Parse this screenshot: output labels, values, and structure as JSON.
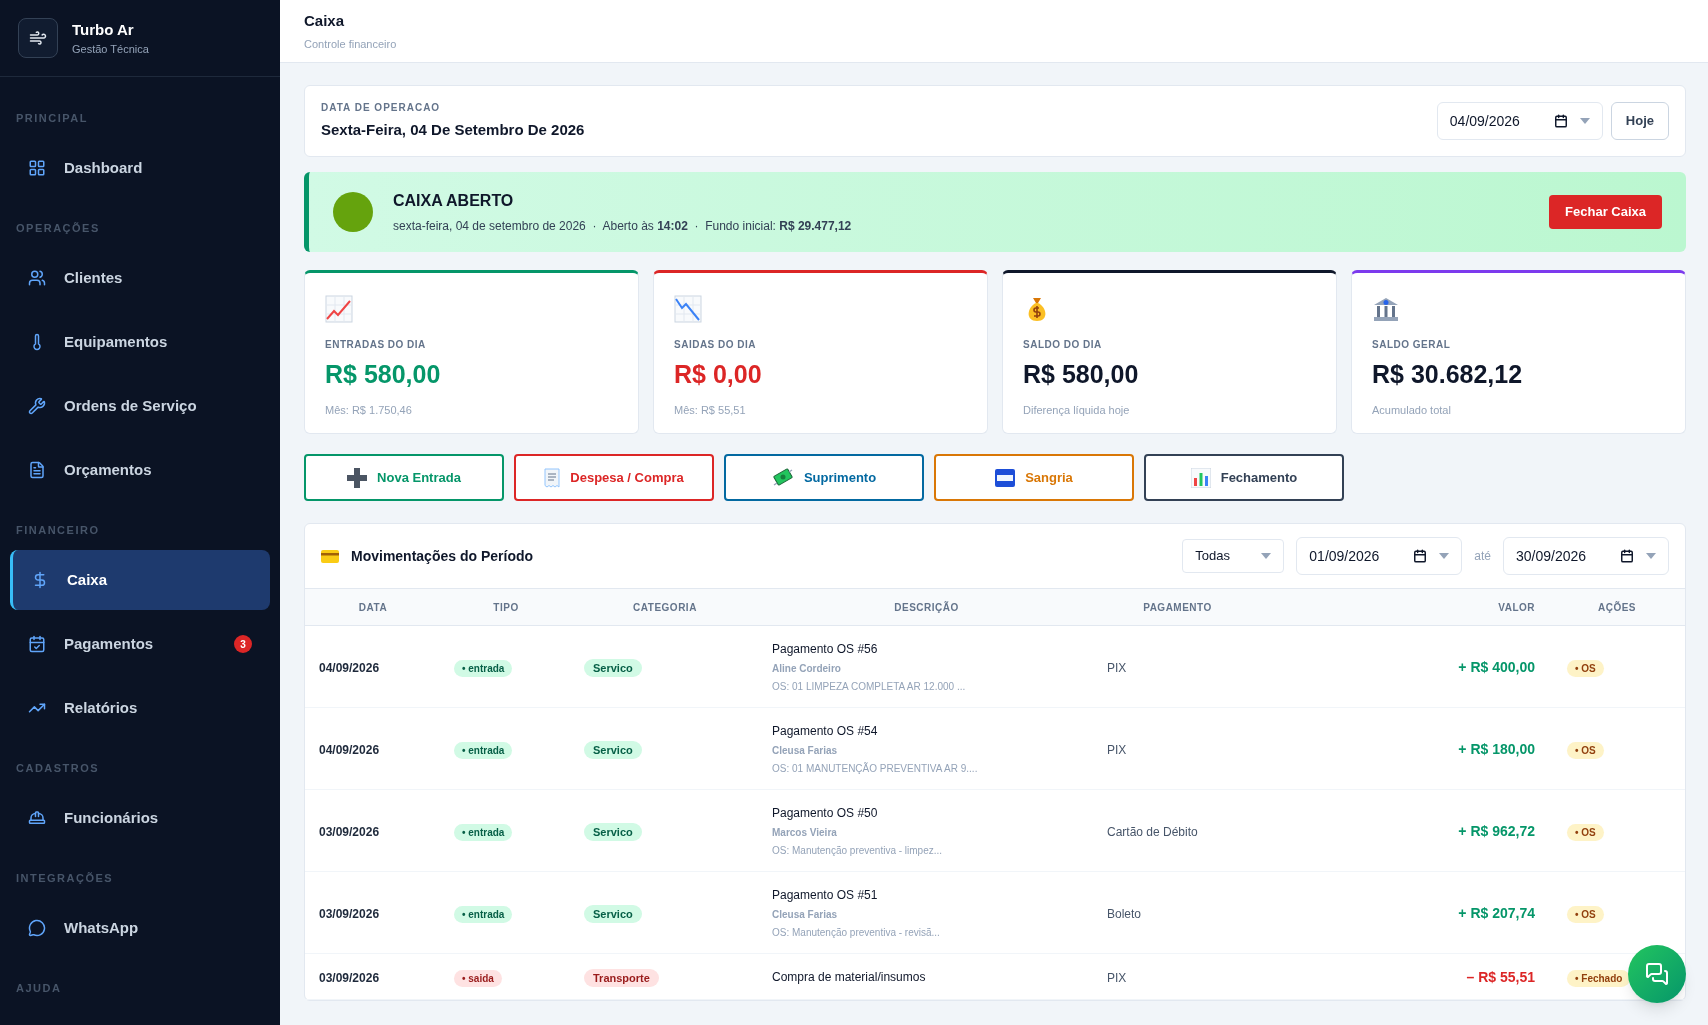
{
  "brand": {
    "name": "Turbo Ar",
    "subtitle": "Gestão Técnica"
  },
  "sidebar": {
    "sections": [
      {
        "label": "PRINCIPAL",
        "items": [
          {
            "label": "Dashboard",
            "selected": false
          }
        ]
      },
      {
        "label": "OPERAÇÕES",
        "items": [
          {
            "label": "Clientes",
            "selected": false
          },
          {
            "label": "Equipamentos",
            "selected": false
          },
          {
            "label": "Ordens de Serviço",
            "selected": false
          },
          {
            "label": "Orçamentos",
            "selected": false
          }
        ]
      },
      {
        "label": "FINANCEIRO",
        "items": [
          {
            "label": "Caixa",
            "selected": true
          },
          {
            "label": "Pagamentos",
            "selected": false,
            "badge": "3"
          },
          {
            "label": "Relatórios",
            "selected": false
          }
        ]
      },
      {
        "label": "CADASTROS",
        "items": [
          {
            "label": "Funcionários",
            "selected": false
          }
        ]
      },
      {
        "label": "INTEGRAÇÕES",
        "items": [
          {
            "label": "WhatsApp",
            "selected": false
          }
        ]
      },
      {
        "label": "AJUDA"
      }
    ]
  },
  "header": {
    "title": "Caixa",
    "subtitle": "Controle financeiro"
  },
  "operation_date": {
    "label": "DATA DE OPERACAO",
    "value": "Sexta-Feira, 04 De Setembro De 2026",
    "date": "04/09/2026",
    "today_button": "Hoje"
  },
  "status_banner": {
    "open": true,
    "title": "CAIXA ABERTO",
    "details": "sexta-feira, 04 de setembro de 2026  ·  Aberto às **14:02**  ·  Fundo inicial: **R$ 29.477,12**",
    "button": "Fechar Caixa"
  },
  "stats": [
    {
      "kind": "in",
      "color": "#059669",
      "label": "ENTRADAS DO DIA",
      "value": "R$ 580,00",
      "note": "Mês: R$ 1.750,46"
    },
    {
      "kind": "out",
      "color": "#dc2626",
      "label": "SAIDAS DO DIA",
      "value": "R$ 0,00",
      "note": "Mês: R$ 55,51"
    },
    {
      "kind": "day",
      "color": "#0f172a",
      "label": "SALDO DO DIA",
      "value": "R$ 580,00",
      "note": "Diferença líquida hoje"
    },
    {
      "kind": "total",
      "color": "#7c3aed",
      "label": "SALDO GERAL",
      "value": "R$ 30.682,12",
      "note": "Acumulado total"
    }
  ],
  "actions": [
    {
      "kind": "plus",
      "label": "Nova Entrada",
      "color": "#059669"
    },
    {
      "kind": "receipt",
      "label": "Despesa / Compra",
      "color": "#dc2626"
    },
    {
      "kind": "money",
      "label": "Suprimento",
      "color": "#0369a1"
    },
    {
      "kind": "atm",
      "label": "Sangria",
      "color": "#d97706"
    },
    {
      "kind": "chart",
      "label": "Fechamento",
      "color": "#334155"
    }
  ],
  "movements": {
    "title": "Movimentações do Período",
    "filter": "Todas",
    "date_from": "01/09/2026",
    "until": "até",
    "date_to": "30/09/2026",
    "columns": [
      "DATA",
      "TIPO",
      "CATEGORIA",
      "DESCRIÇÃO",
      "PAGAMENTO",
      "VALOR",
      "AÇÕES"
    ],
    "rows": [
      {
        "kind": "in",
        "date": "04/09/2026",
        "type": "• entrada",
        "category": "Servico",
        "description": "Pagamento OS #56",
        "client": "Aline Cordeiro",
        "detail": "OS: 01 LIMPEZA COMPLETA AR 12.000 ...",
        "payment": "PIX",
        "value": "+ R$ 400,00",
        "action": "• OS"
      },
      {
        "kind": "in",
        "date": "04/09/2026",
        "type": "• entrada",
        "category": "Servico",
        "description": "Pagamento OS #54",
        "client": "Cleusa Farias",
        "detail": "OS: 01 MANUTENÇÃO PREVENTIVA AR 9....",
        "payment": "PIX",
        "value": "+ R$ 180,00",
        "action": "• OS"
      },
      {
        "kind": "in",
        "date": "03/09/2026",
        "type": "• entrada",
        "category": "Servico",
        "description": "Pagamento OS #50",
        "client": "Marcos Vieira",
        "detail": "OS: Manutenção preventiva - limpez...",
        "payment": "Cartão de Débito",
        "value": "+ R$ 962,72",
        "action": "• OS"
      },
      {
        "kind": "in",
        "date": "03/09/2026",
        "type": "• entrada",
        "category": "Servico",
        "description": "Pagamento OS #51",
        "client": "Cleusa Farias",
        "detail": "OS: Manutenção preventiva - revisã...",
        "payment": "Boleto",
        "value": "+ R$ 207,74",
        "action": "• OS"
      },
      {
        "kind": "out",
        "date": "03/09/2026",
        "type": "• saida",
        "category": "Transporte",
        "description": "Compra de material/insumos",
        "payment": "PIX",
        "value": "– R$ 55,51",
        "action": "• Fechado"
      }
    ]
  }
}
